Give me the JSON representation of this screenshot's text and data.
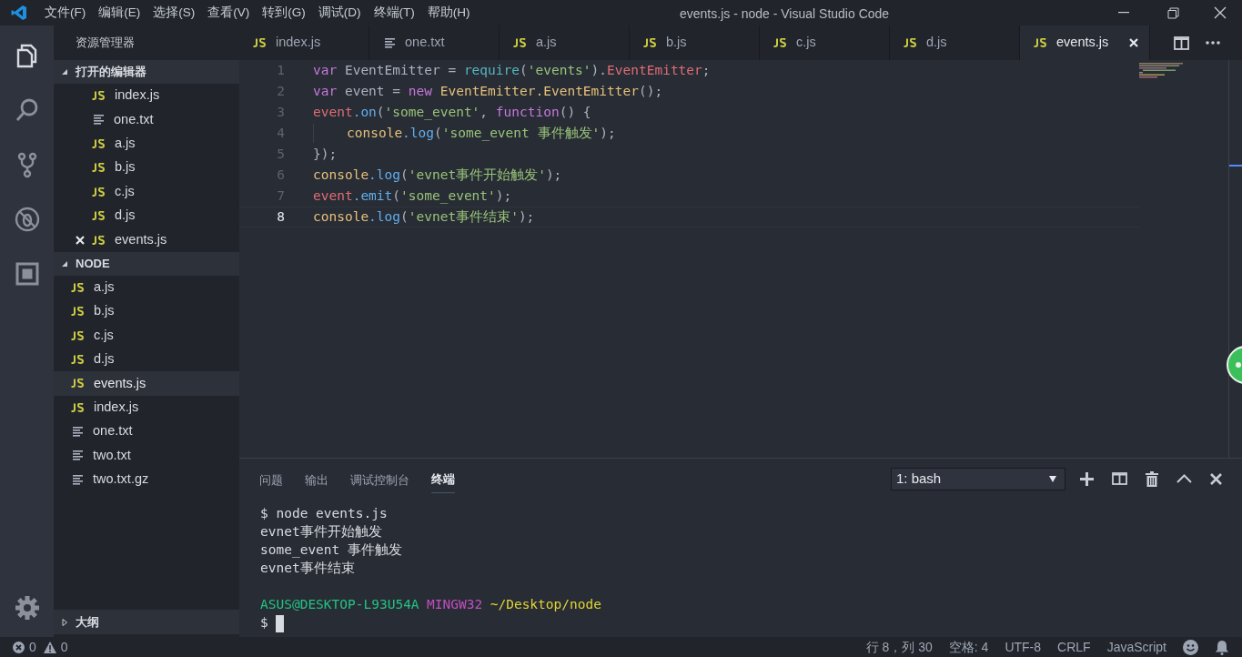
{
  "window": {
    "title": "events.js - node - Visual Studio Code"
  },
  "menu": [
    "文件(F)",
    "编辑(E)",
    "选择(S)",
    "查看(V)",
    "转到(G)",
    "调试(D)",
    "终端(T)",
    "帮助(H)"
  ],
  "activity_bar": [
    {
      "kind": "files",
      "selected": true
    },
    {
      "kind": "search",
      "selected": false
    },
    {
      "kind": "git",
      "selected": false
    },
    {
      "kind": "debug",
      "selected": false
    },
    {
      "kind": "extensions",
      "selected": false
    }
  ],
  "sidebar": {
    "title": "资源管理器",
    "sections": [
      {
        "title": "打开的编辑器",
        "kind": "open_editors",
        "expanded": true,
        "items": [
          {
            "name": "index.js",
            "kind": "js",
            "selected": false,
            "close_visible": false
          },
          {
            "name": "one.txt",
            "kind": "txt",
            "selected": false,
            "close_visible": false
          },
          {
            "name": "a.js",
            "kind": "js",
            "selected": false,
            "close_visible": false
          },
          {
            "name": "b.js",
            "kind": "js",
            "selected": false,
            "close_visible": false
          },
          {
            "name": "c.js",
            "kind": "js",
            "selected": false,
            "close_visible": false
          },
          {
            "name": "d.js",
            "kind": "js",
            "selected": false,
            "close_visible": false
          },
          {
            "name": "events.js",
            "kind": "js",
            "selected": false,
            "close_visible": true
          }
        ]
      },
      {
        "title": "NODE",
        "kind": "folder",
        "expanded": true,
        "items": [
          {
            "name": "a.js",
            "kind": "js",
            "selected": false
          },
          {
            "name": "b.js",
            "kind": "js",
            "selected": false
          },
          {
            "name": "c.js",
            "kind": "js",
            "selected": false
          },
          {
            "name": "d.js",
            "kind": "js",
            "selected": false
          },
          {
            "name": "events.js",
            "kind": "js",
            "selected": true
          },
          {
            "name": "index.js",
            "kind": "js",
            "selected": false
          },
          {
            "name": "one.txt",
            "kind": "txt",
            "selected": false
          },
          {
            "name": "two.txt",
            "kind": "txt",
            "selected": false
          },
          {
            "name": "two.txt.gz",
            "kind": "txt",
            "selected": false
          }
        ]
      }
    ],
    "outline": {
      "title": "大纲",
      "expanded": false
    }
  },
  "tabs": [
    {
      "label": "index.js",
      "kind": "js",
      "selected": false
    },
    {
      "label": "one.txt",
      "kind": "txt",
      "selected": false
    },
    {
      "label": "a.js",
      "kind": "js",
      "selected": false
    },
    {
      "label": "b.js",
      "kind": "js",
      "selected": false
    },
    {
      "label": "c.js",
      "kind": "js",
      "selected": false
    },
    {
      "label": "d.js",
      "kind": "js",
      "selected": false
    },
    {
      "label": "events.js",
      "kind": "js",
      "selected": true
    }
  ],
  "editor": {
    "lines": [
      {
        "number": "1",
        "current": false,
        "indent_guide": false,
        "tokens": [
          {
            "text": "var",
            "kind": "keyword"
          },
          {
            "text": " EventEmitter = ",
            "kind": "plain"
          },
          {
            "text": "require",
            "kind": "builtin"
          },
          {
            "text": "(",
            "kind": "plain"
          },
          {
            "text": "'events'",
            "kind": "string"
          },
          {
            "text": ").",
            "kind": "plain"
          },
          {
            "text": "EventEmitter",
            "kind": "variable"
          },
          {
            "text": ";",
            "kind": "plain"
          }
        ]
      },
      {
        "number": "2",
        "current": false,
        "indent_guide": false,
        "tokens": [
          {
            "text": "var",
            "kind": "keyword"
          },
          {
            "text": " event = ",
            "kind": "plain"
          },
          {
            "text": "new",
            "kind": "keyword"
          },
          {
            "text": " EventEmitter",
            "kind": "type"
          },
          {
            "text": ".EventEmitter",
            "kind": "type"
          },
          {
            "text": "();",
            "kind": "plain"
          }
        ]
      },
      {
        "number": "3",
        "current": false,
        "indent_guide": false,
        "tokens": [
          {
            "text": "event",
            "kind": "variable"
          },
          {
            "text": ".on",
            "kind": "method"
          },
          {
            "text": "(",
            "kind": "plain"
          },
          {
            "text": "'some_event'",
            "kind": "string"
          },
          {
            "text": ", ",
            "kind": "plain"
          },
          {
            "text": "function",
            "kind": "keyword"
          },
          {
            "text": "() {",
            "kind": "plain"
          }
        ]
      },
      {
        "number": "4",
        "current": false,
        "indent_guide": true,
        "tokens": [
          {
            "text": "console",
            "kind": "type"
          },
          {
            "text": ".log",
            "kind": "method"
          },
          {
            "text": "(",
            "kind": "plain"
          },
          {
            "text": "'some_event 事件触发'",
            "kind": "string"
          },
          {
            "text": ");",
            "kind": "plain"
          }
        ]
      },
      {
        "number": "5",
        "current": false,
        "indent_guide": false,
        "tokens": [
          {
            "text": "});",
            "kind": "plain"
          }
        ]
      },
      {
        "number": "6",
        "current": false,
        "indent_guide": false,
        "tokens": [
          {
            "text": "console",
            "kind": "type"
          },
          {
            "text": ".log",
            "kind": "method"
          },
          {
            "text": "(",
            "kind": "plain"
          },
          {
            "text": "'evnet事件开始触发'",
            "kind": "string"
          },
          {
            "text": ");",
            "kind": "plain"
          }
        ]
      },
      {
        "number": "7",
        "current": false,
        "indent_guide": false,
        "tokens": [
          {
            "text": "event",
            "kind": "variable"
          },
          {
            "text": ".emit",
            "kind": "method"
          },
          {
            "text": "(",
            "kind": "plain"
          },
          {
            "text": "'some_event'",
            "kind": "string"
          },
          {
            "text": ");",
            "kind": "plain"
          }
        ]
      },
      {
        "number": "8",
        "current": true,
        "indent_guide": false,
        "tokens": [
          {
            "text": "console",
            "kind": "type"
          },
          {
            "text": ".log",
            "kind": "method"
          },
          {
            "text": "(",
            "kind": "plain"
          },
          {
            "text": "'evnet事件结束'",
            "kind": "string"
          },
          {
            "text": ");",
            "kind": "plain"
          }
        ]
      }
    ]
  },
  "panel": {
    "tabs": [
      {
        "label": "问题",
        "selected": false
      },
      {
        "label": "输出",
        "selected": false
      },
      {
        "label": "调试控制台",
        "selected": false
      },
      {
        "label": "终端",
        "selected": true
      }
    ],
    "terminal_select": {
      "value": "1: bash"
    },
    "terminal": [
      {
        "kind": "output",
        "segments": [
          {
            "text": "$ node events.js",
            "kind": "plain"
          }
        ]
      },
      {
        "kind": "output",
        "segments": [
          {
            "text": "evnet事件开始触发",
            "kind": "plain"
          }
        ]
      },
      {
        "kind": "output",
        "segments": [
          {
            "text": "some_event 事件触发",
            "kind": "plain"
          }
        ]
      },
      {
        "kind": "output",
        "segments": [
          {
            "text": "evnet事件结束",
            "kind": "plain"
          }
        ]
      },
      {
        "kind": "blank"
      },
      {
        "kind": "output",
        "segments": [
          {
            "text": "ASUS@DESKTOP-L93U54A",
            "kind": "user"
          },
          {
            "text": "MINGW32",
            "kind": "system"
          },
          {
            "text": "~/Desktop/node",
            "kind": "path"
          }
        ]
      },
      {
        "kind": "output",
        "segments": [
          {
            "text": "$",
            "kind": "plain"
          }
        ],
        "cursor": true
      }
    ]
  },
  "status_bar": {
    "errors": "0",
    "warnings": "0",
    "items": [
      "行 8，列 30",
      "空格: 4",
      "UTF-8",
      "CRLF",
      "JavaScript"
    ]
  }
}
